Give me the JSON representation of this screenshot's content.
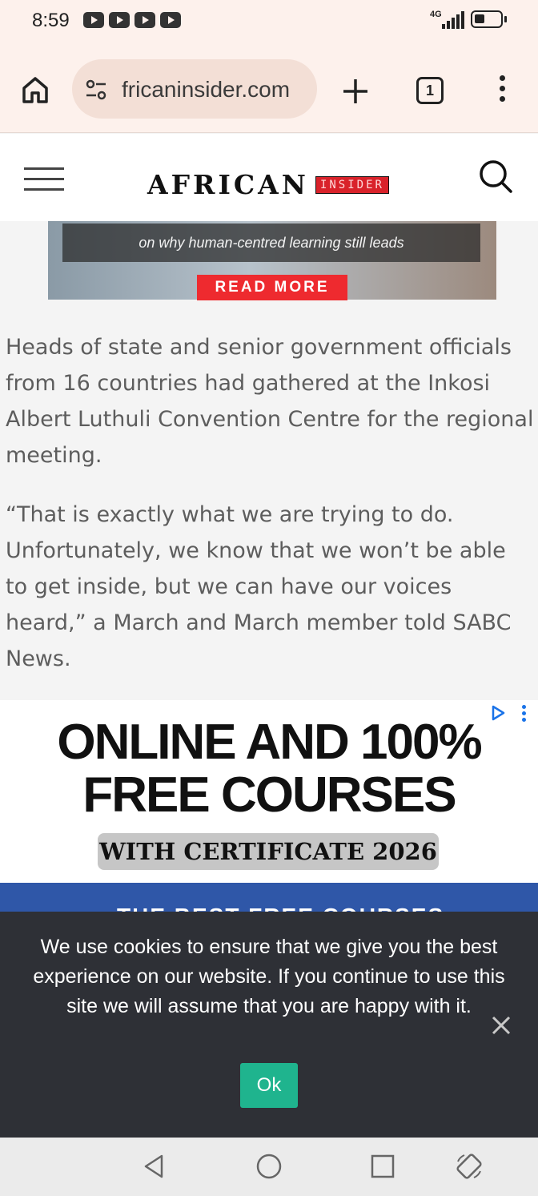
{
  "status_bar": {
    "time": "8:59",
    "network": "4G"
  },
  "browser": {
    "url": "fricaninsider.com",
    "tab_count": "1"
  },
  "site": {
    "logo_main": "AFRICAN",
    "logo_badge": "INSIDER"
  },
  "banner": {
    "caption": "on why human-centred learning still leads",
    "read_more": "READ MORE"
  },
  "article": {
    "paragraphs": [
      "Heads of state and senior government officials from 16 countries had gathered at the Inkosi Albert Luthuli Convention Centre for the regional meeting.",
      "“That is exactly what we are trying to do. Unfortunately, we know that we won’t be able to get inside, but we can have our voices heard,” a March and March member told SABC News."
    ]
  },
  "ad": {
    "headline_line1": "ONLINE AND 100%",
    "headline_line2": "FREE COURSES",
    "subline": "WITH CERTIFICATE 2026",
    "footer_partial": "THE BEST FREE COURSES",
    "choices_icon": "adchoices-icon",
    "accent_color": "#2f57a8"
  },
  "cookie": {
    "message": "We use cookies to ensure that we give you the best experience on our website. If you continue to use this site we will assume that you are happy with it.",
    "ok_label": "Ok",
    "ok_color": "#1fb48e"
  },
  "icons": [
    "home-icon",
    "tune-icon",
    "plus-icon",
    "menu-dots-icon",
    "hamburger-icon",
    "search-icon",
    "close-icon",
    "back-icon",
    "home-circle-icon",
    "recents-icon",
    "rotate-icon"
  ]
}
